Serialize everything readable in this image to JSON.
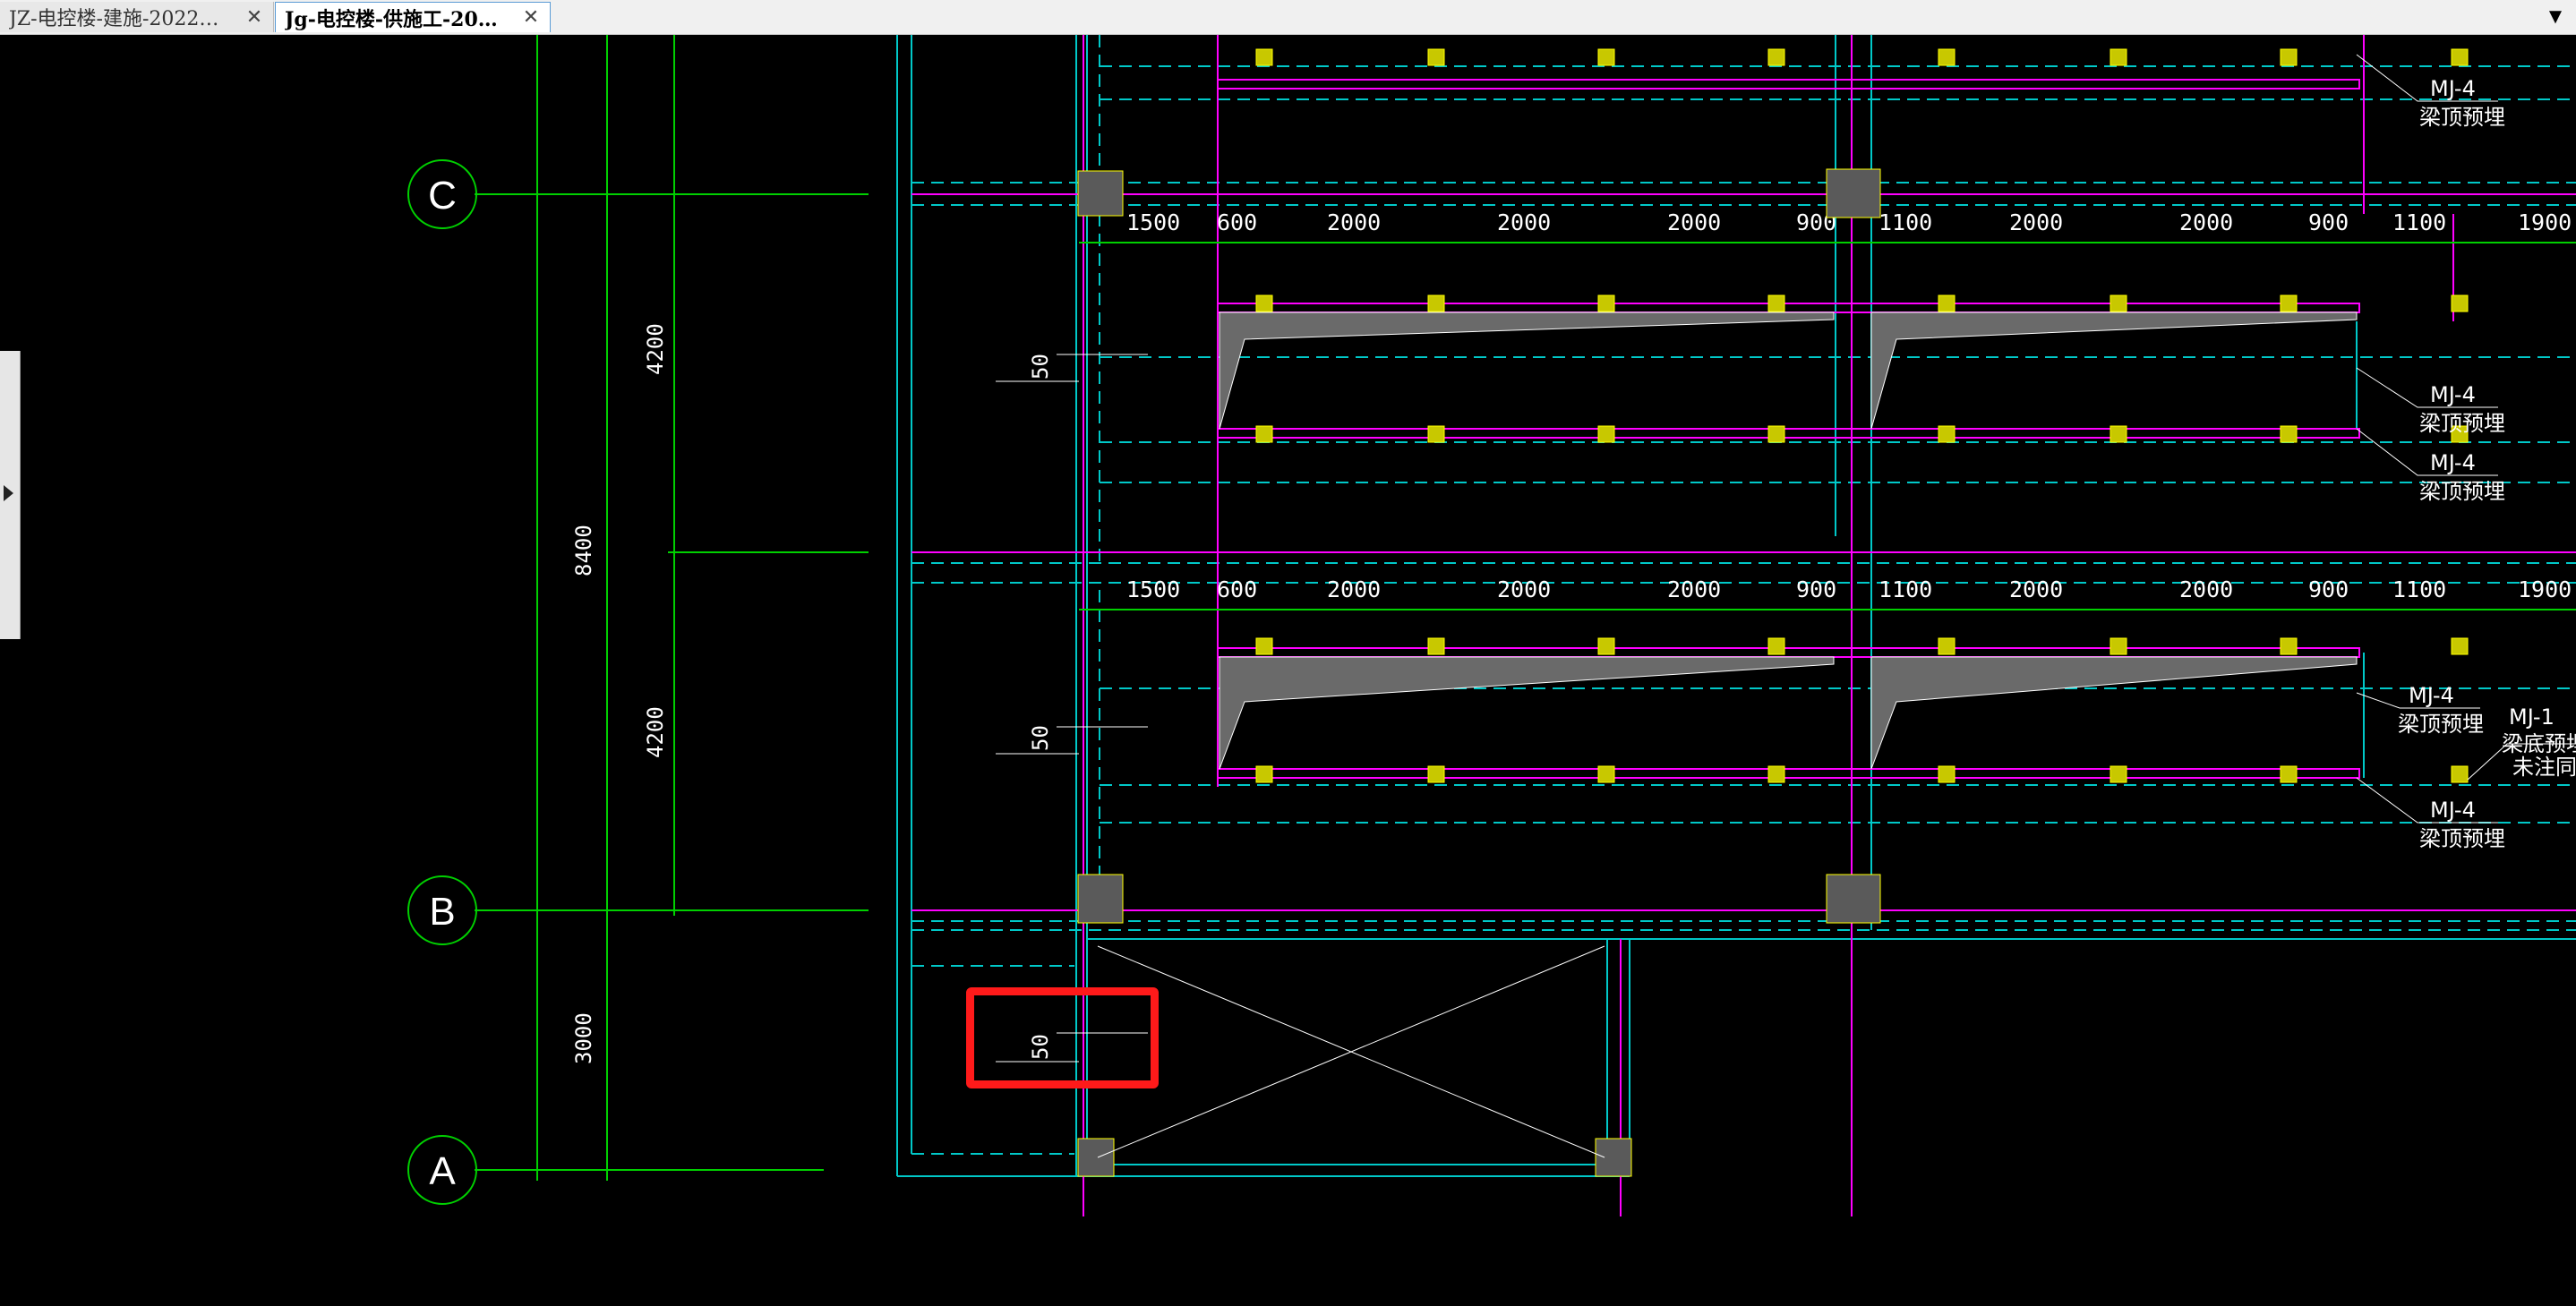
{
  "tabs": [
    {
      "label": "JZ-电控楼-建施-2022…",
      "close": "✕"
    },
    {
      "label": "Jg-电控楼-供施工-20…",
      "close": "✕"
    }
  ],
  "tab_menu_icon": "triangle-down-icon",
  "grid": {
    "axis_C": "C",
    "axis_B": "B",
    "axis_A": "A",
    "dim_total": "8400",
    "dim_upper": "4200",
    "dim_lower": "4200",
    "dim_bottom": "3000",
    "row1_dims": [
      "1500",
      "600",
      "2000",
      "2000",
      "2000",
      "900",
      "1100",
      "2000",
      "2000",
      "900",
      "1100",
      "1900"
    ],
    "row2_dims": [
      "1500",
      "600",
      "2000",
      "2000",
      "2000",
      "900",
      "1100",
      "2000",
      "2000",
      "900",
      "1100",
      "1900"
    ],
    "small_dim": "50"
  },
  "labels": {
    "mj4": "MJ-4",
    "liang_ding": "梁顶预埋",
    "mj1": "MJ-1",
    "liang_di": "梁底预埋",
    "wei_zhu": "未注同"
  },
  "colors": {
    "tab_active_border": "#5b9bd5",
    "highlight": "#ff1a1a",
    "green": "#00d000",
    "cyan": "#00c8c8",
    "magenta": "#ff00ff",
    "yellow": "#ffff00",
    "white": "#ffffff"
  }
}
